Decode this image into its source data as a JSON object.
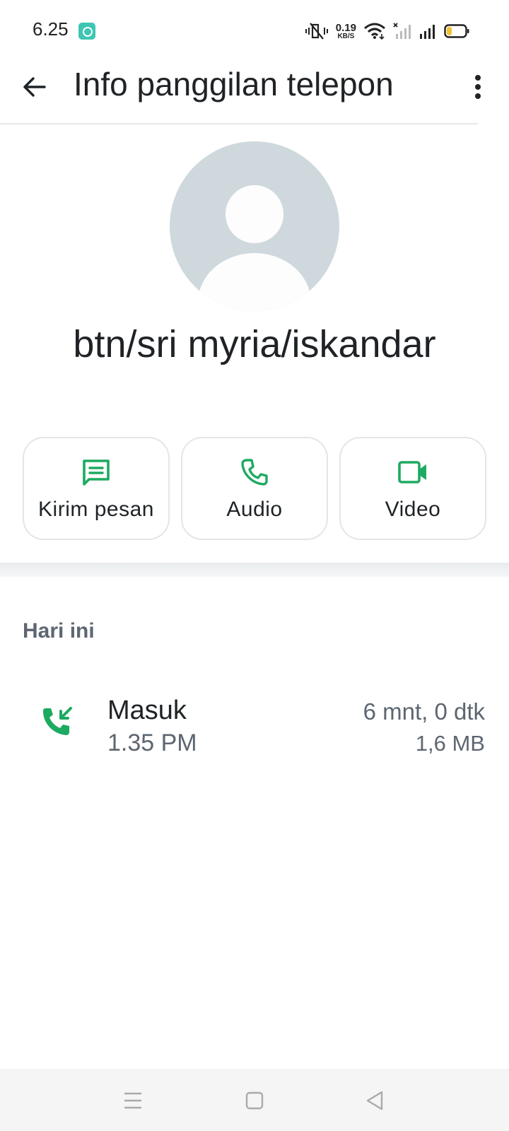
{
  "status_bar": {
    "time": "6.25",
    "net_speed_value": "0.19",
    "net_speed_unit": "KB/S",
    "battery_level": 0.2
  },
  "app_bar": {
    "title": "Info panggilan telepon"
  },
  "contact": {
    "name": "btn/sri myria/iskandar"
  },
  "actions": [
    {
      "label": "Kirim pesan",
      "icon": "message-icon"
    },
    {
      "label": "Audio",
      "icon": "phone-icon"
    },
    {
      "label": "Video",
      "icon": "video-icon"
    }
  ],
  "section": {
    "title": "Hari ini"
  },
  "calls": [
    {
      "type": "Masuk",
      "time": "1.35 PM",
      "duration": "6 mnt, 0 dtk",
      "size": "1,6 MB",
      "icon": "incoming-call-icon"
    }
  ],
  "colors": {
    "accent": "#1daa61",
    "text_primary": "#1f2326",
    "text_secondary": "#5d6670",
    "avatar_bg": "#cfd9dd"
  }
}
